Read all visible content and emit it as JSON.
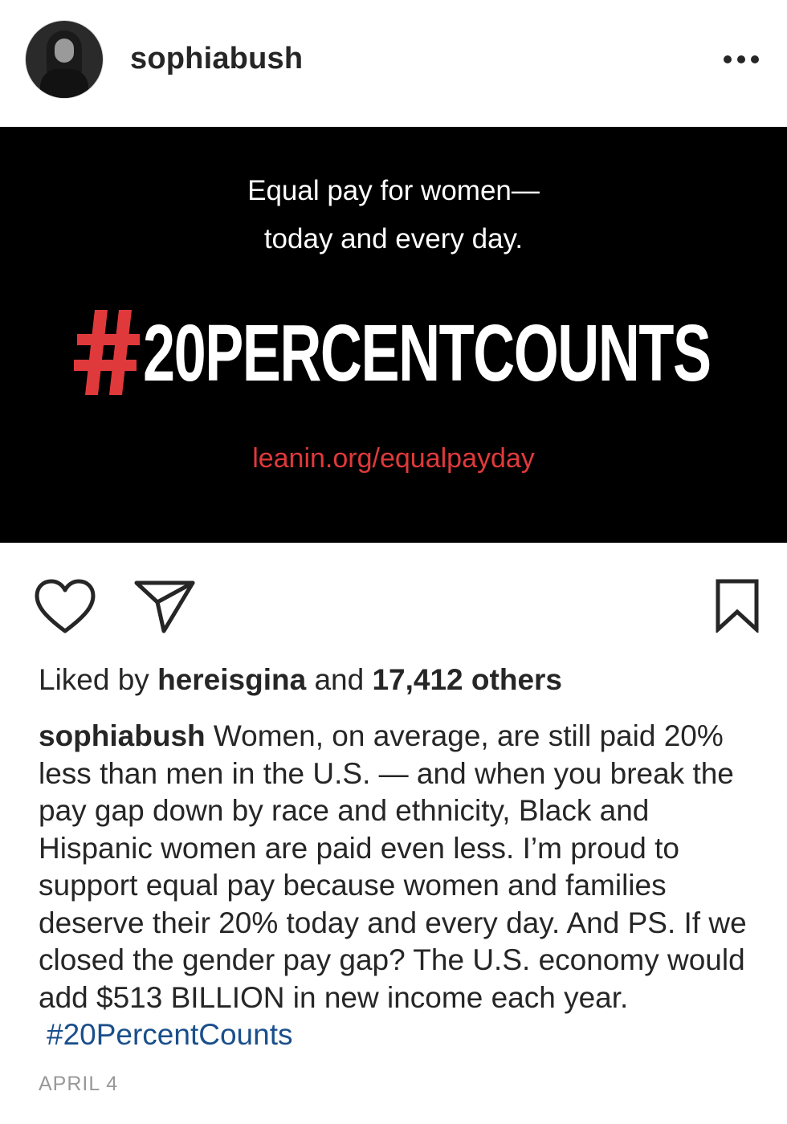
{
  "header": {
    "username": "sophiabush",
    "avatar_alt": "profile-photo",
    "more_icon": "more-horizontal-icon"
  },
  "image": {
    "line1": "Equal pay for women—",
    "line2": "today and every day.",
    "hashtag_symbol": "#",
    "hashtag_text": "20PERCENTCOUNTS",
    "link": "leanin.org/equalpayday",
    "colors": {
      "background": "#000000",
      "accent": "#e0393b",
      "text": "#ffffff"
    }
  },
  "actions": {
    "like_icon": "heart-icon",
    "share_icon": "paper-plane-icon",
    "save_icon": "bookmark-icon"
  },
  "likes": {
    "prefix": "Liked by",
    "user": "hereisgina",
    "middle": "and",
    "count_text": "17,412 others"
  },
  "caption": {
    "username": "sophiabush",
    "text": "Women, on average, are still paid 20% less than men in the U.S. — and when you break the pay gap down by race and ethnicity, Black and Hispanic women are paid even less. I’m proud to support equal pay because women and families deserve their 20% today and every day. And PS. If we closed the gender pay gap? The U.S. economy would add $513 BILLION in new income each year.",
    "hashtag": "#20PercentCounts",
    "hashtag_color": "#1a4f8b"
  },
  "date": "APRIL 4"
}
